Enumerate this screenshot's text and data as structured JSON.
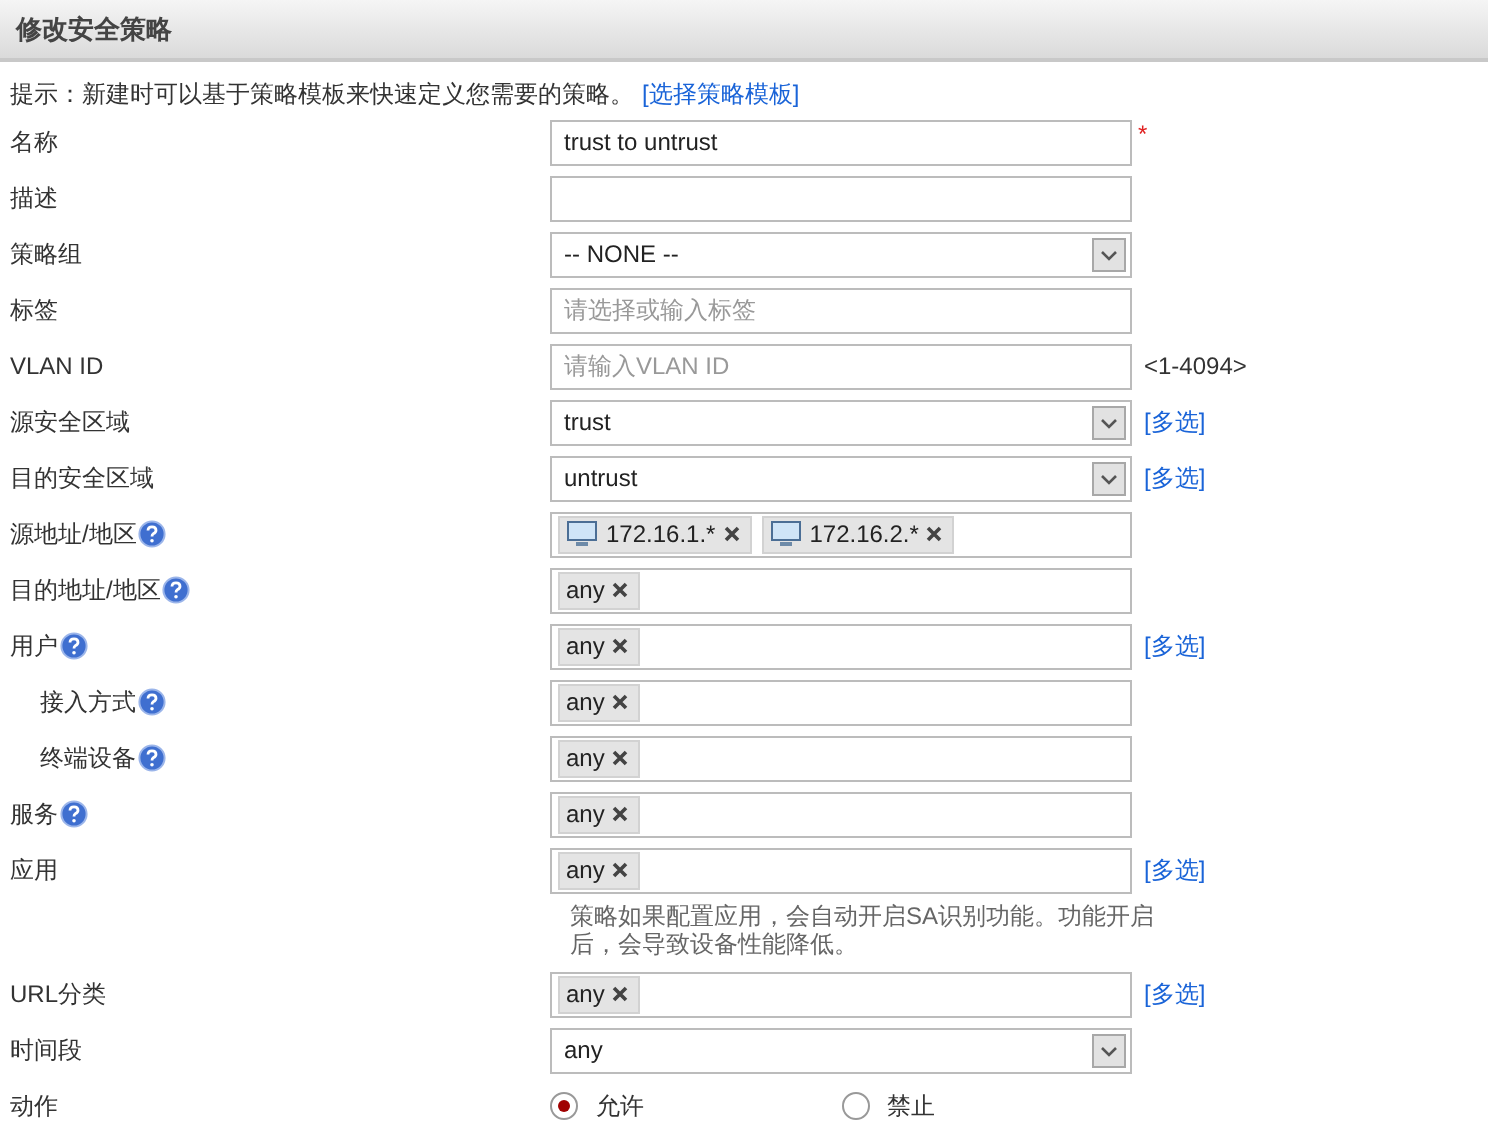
{
  "header": {
    "title": "修改安全策略"
  },
  "hint": {
    "text": "提示：新建时可以基于策略模板来快速定义您需要的策略。",
    "link": "[选择策略模板]"
  },
  "fields": [
    {
      "label": "名称",
      "kind": "text",
      "value": "trust to untrust",
      "required_mark": "*"
    },
    {
      "label": "描述",
      "kind": "text"
    },
    {
      "label": "策略组",
      "kind": "select",
      "value": "-- NONE --"
    },
    {
      "label": "标签",
      "kind": "text",
      "placeholder": "请选择或输入标签"
    },
    {
      "label": "VLAN ID",
      "kind": "text",
      "placeholder": "请输入VLAN ID",
      "suffix": "<1-4094>"
    },
    {
      "label": "源安全区域",
      "kind": "select",
      "value": "trust",
      "link": "[多选]"
    },
    {
      "label": "目的安全区域",
      "kind": "select",
      "value": "untrust",
      "link": "[多选]"
    },
    {
      "label": "源地址/地区",
      "help": true,
      "kind": "tags",
      "tags": [
        {
          "text": "172.16.1.*",
          "has_icon": true
        },
        {
          "text": "172.16.2.*",
          "has_icon": true
        }
      ]
    },
    {
      "label": "目的地址/地区",
      "help": true,
      "kind": "tags",
      "tags": [
        {
          "text": "any",
          "has_icon": false
        }
      ]
    },
    {
      "label": "用户",
      "help": true,
      "kind": "tags",
      "tags": [
        {
          "text": "any",
          "has_icon": false
        }
      ],
      "link": "[多选]",
      "children": [
        {
          "label": "接入方式",
          "help": true,
          "kind": "tags",
          "tags": [
            {
              "text": "any",
              "has_icon": false
            }
          ]
        },
        {
          "label": "终端设备",
          "help": true,
          "kind": "tags",
          "tags": [
            {
              "text": "any",
              "has_icon": false
            }
          ]
        }
      ]
    },
    {
      "label": "服务",
      "help": true,
      "kind": "tags",
      "tags": [
        {
          "text": "any",
          "has_icon": false
        }
      ]
    },
    {
      "label": "应用",
      "kind": "tags",
      "tags": [
        {
          "text": "any",
          "has_icon": false
        }
      ],
      "link": "[多选]",
      "note": "策略如果配置应用，会自动开启SA识别功能。功能开启后，会导致设备性能降低。"
    },
    {
      "label": "URL分类",
      "kind": "tags",
      "tags": [
        {
          "text": "any",
          "has_icon": false
        }
      ],
      "link": "[多选]"
    },
    {
      "label": "时间段",
      "kind": "select",
      "value": "any"
    },
    {
      "label": "动作",
      "kind": "radio",
      "options": [
        {
          "label": "允许",
          "selected": true
        },
        {
          "label": "禁止",
          "selected": false
        }
      ]
    }
  ]
}
